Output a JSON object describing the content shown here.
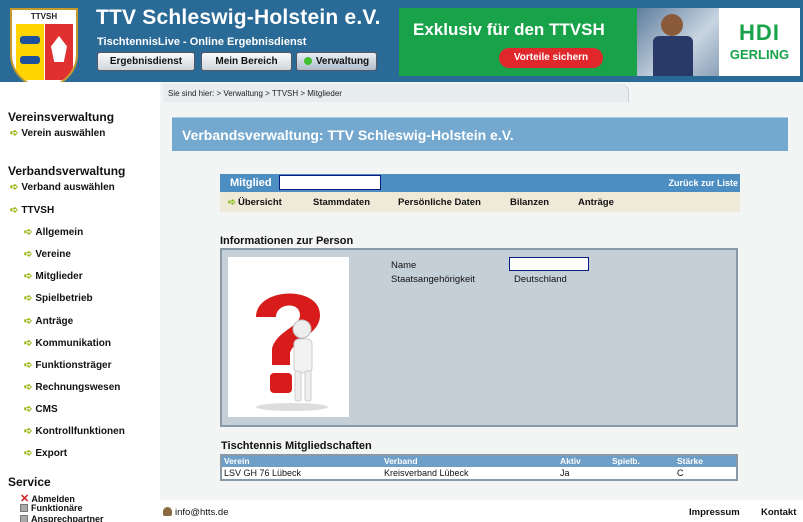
{
  "header": {
    "logo_text": "TTVSH",
    "title": "TTV Schleswig-Holstein e.V.",
    "subtitle": "TischtennisLive - Online Ergebnisdienst",
    "buttons": [
      "Ergebnisdienst",
      "Mein Bereich",
      "Verwaltung"
    ],
    "active_button_status_color": "#3fbf2f"
  },
  "ad": {
    "headline": "Exklusiv für den TTVSH",
    "cta": "Vorteile sichern",
    "brand_line1": "HDI",
    "brand_line2": "GERLING",
    "accent": "#18a24a"
  },
  "breadcrumb": "Sie sind hier: > Verwaltung > TTVSH > Mitglieder",
  "page_title": "Verbandsverwaltung: TTV Schleswig-Holstein e.V.",
  "sidebar": {
    "section1": {
      "title": "Vereinsverwaltung",
      "items": [
        "Verein auswählen"
      ]
    },
    "section2": {
      "title": "Verbandsverwaltung",
      "items": [
        "Verband auswählen",
        "TTVSH"
      ],
      "sub_items": [
        "Allgemein",
        "Vereine",
        "Mitglieder",
        "Spielbetrieb",
        "Anträge",
        "Kommunikation",
        "Funktionsträger",
        "Rechnungswesen",
        "CMS",
        "Kontrollfunktionen",
        "Export"
      ]
    },
    "service": {
      "title": "Service",
      "items": [
        "Abmelden",
        "Funktionäre",
        "Ansprechpartner"
      ]
    }
  },
  "member_bar": {
    "label": "Mitglied",
    "value": "",
    "back": "Zurück zur Liste"
  },
  "subnav": [
    "Übersicht",
    "Stammdaten",
    "Persönliche Daten",
    "Bilanzen",
    "Anträge"
  ],
  "info": {
    "heading": "Informationen zur Person",
    "name_label": "Name",
    "name_value": "",
    "nationality_label": "Staatsangehörigkeit",
    "nationality_value": "Deutschland"
  },
  "memberships": {
    "heading": "Tischtennis Mitgliedschaften",
    "columns": [
      "Verein",
      "Verband",
      "Aktiv",
      "Spielb.",
      "Stärke"
    ],
    "rows": [
      [
        "LSV GH 76 Lübeck",
        "Kreisverband Lübeck",
        "Ja",
        "",
        "C"
      ]
    ]
  },
  "footer": {
    "email": "info@htts.de",
    "impressum": "Impressum",
    "kontakt": "Kontakt"
  }
}
